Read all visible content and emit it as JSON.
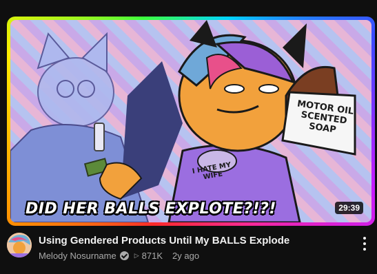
{
  "video": {
    "thumbnail_caption": "DID HER BALLS EXPLOTE?!?!",
    "soap_label": "MOTOR OIL SCENTED SOAP",
    "shirt_text": "I HATE MY WIFE",
    "duration": "29:39",
    "title": "Using Gendered Products Until My BALLS Explode",
    "channel": "Melody Nosurname",
    "views": "871K",
    "age": "2y ago"
  },
  "icons": {
    "verified": "verified-check-icon",
    "views": "play-triangle-icon",
    "menu": "more-vert-icon"
  },
  "colors": {
    "background": "#0f0f0f",
    "title_text": "#f1f1f1",
    "meta_text": "#aaaaaa"
  }
}
